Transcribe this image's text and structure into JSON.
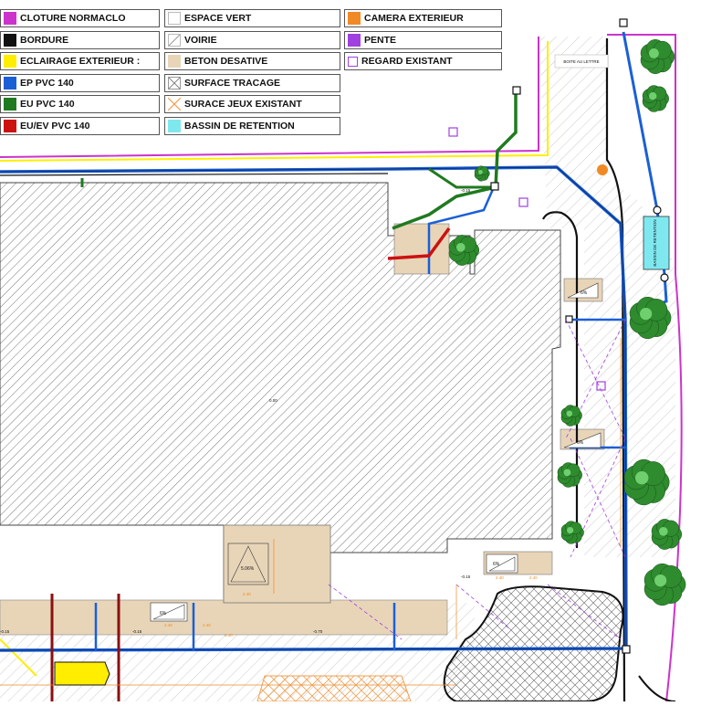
{
  "legend": {
    "col1": [
      {
        "label": "CLOTURE NORMACLO",
        "color": "#cc33cc",
        "kind": "solid"
      },
      {
        "label": "BORDURE",
        "color": "#111111",
        "kind": "solid"
      },
      {
        "label": "ECLAIRAGE EXTERIEUR :",
        "color": "#ffee00",
        "kind": "solid"
      },
      {
        "label": "EP PVC 140",
        "color": "#1a5fd6",
        "kind": "solid"
      },
      {
        "label": "EU PVC 140",
        "color": "#1f7a1f",
        "kind": "solid"
      },
      {
        "label": "EU/EV PVC 140",
        "color": "#cc1111",
        "kind": "solid"
      }
    ],
    "col2": [
      {
        "label": "ESPACE VERT",
        "color": "#ffffff",
        "kind": "empty"
      },
      {
        "label": "VOIRIE",
        "color": "#ffffff",
        "kind": "diag"
      },
      {
        "label": "BETON DESATIVE",
        "color": "#e8d5b8",
        "kind": "solid"
      },
      {
        "label": "SURFACE TRACAGE",
        "color": "#999999",
        "kind": "cross"
      },
      {
        "label": "SURACE JEUX EXISTANT",
        "color": "#f0a050",
        "kind": "crossorange"
      },
      {
        "label": "BASSIN DE RETENTION",
        "color": "#7fe8ef",
        "kind": "solid"
      }
    ],
    "col3": [
      {
        "label": "CAMERA EXTERIEUR",
        "color": "#f08a24",
        "kind": "solid"
      },
      {
        "label": "PENTE",
        "color": "#a040e0",
        "kind": "solid"
      },
      {
        "label": "REGARD EXISTANT",
        "color": "#a040e0",
        "kind": "outline"
      }
    ]
  },
  "plan": {
    "boite_label": "BOITE AU LETTRE",
    "bassin_label": "BASSIN DE RETENTION",
    "slopes": [
      "6%",
      "5.06%",
      "6%",
      "6%",
      "6%"
    ],
    "levels": [
      "-0.15",
      "-0.15",
      "-0.15",
      "-0.70",
      "0.00",
      "-0.15"
    ],
    "dims": [
      "2.40",
      "2.40",
      "2.40",
      "2.40",
      "2.40",
      "2.40"
    ]
  },
  "colors": {
    "fence": "#cc33cc",
    "curb": "#111111",
    "lighting": "#ffee00",
    "ep": "#1a5fd6",
    "eu": "#1f7a1f",
    "euev": "#cc1111",
    "concrete": "#e8d5b8",
    "basin": "#7fe8ef",
    "camera": "#f08a24",
    "slope": "#a040e0",
    "tree": "#2e8b2e"
  }
}
